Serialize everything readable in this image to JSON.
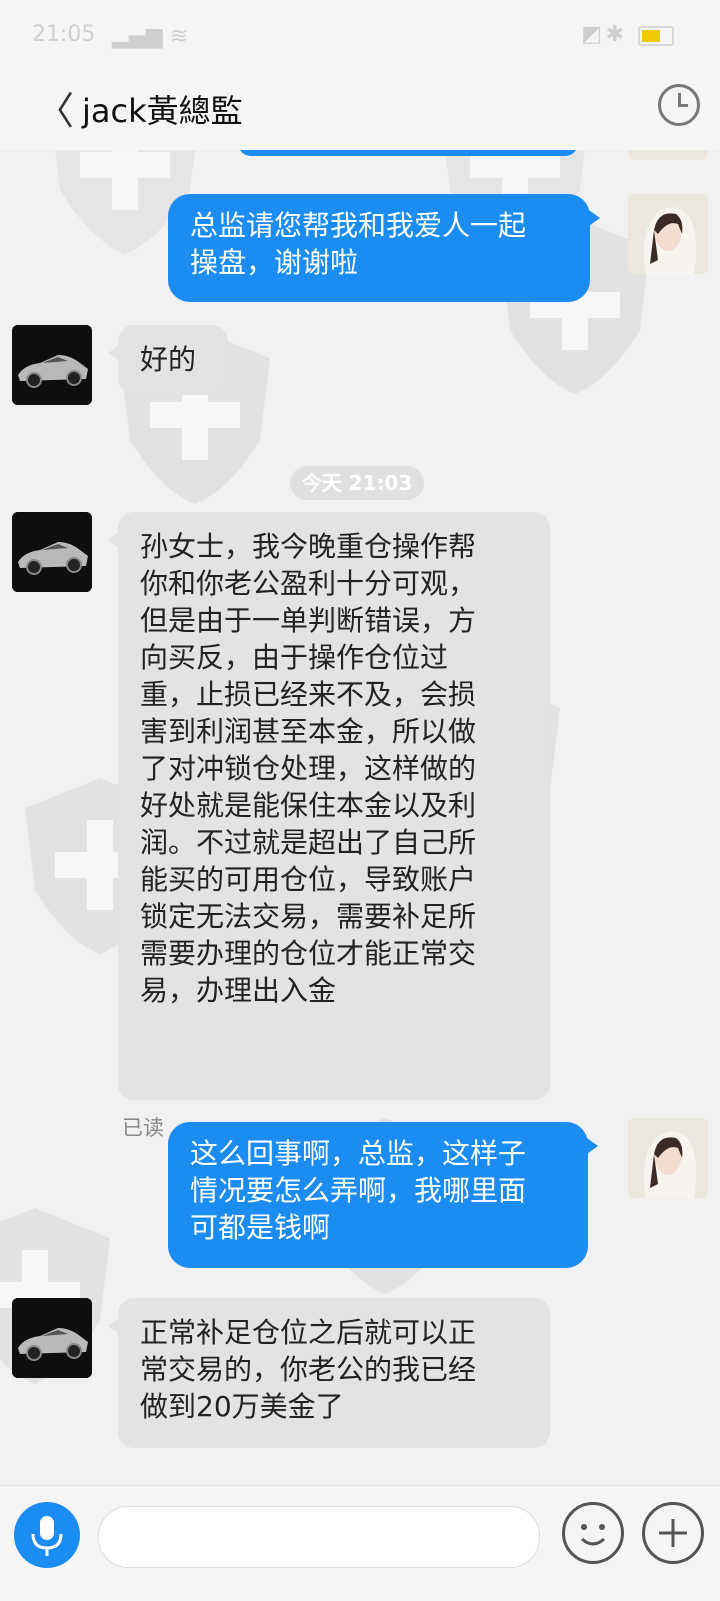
{
  "status_bar": {
    "time": "21:05",
    "signal": "ᵃᵃᵃ",
    "bluetooth": "✱",
    "nodisturb": "▧"
  },
  "header": {
    "back_icon": "<",
    "title": "jack黃總監"
  },
  "messages": [
    {
      "side": "out",
      "text": "总监请您帮我和我爱人一起\n操盘，谢谢啦"
    },
    {
      "side": "in",
      "text": "好的"
    },
    {
      "side": "in",
      "text": "孙女士，我今晚重仓操作帮\n你和你老公盈利十分可观，\n但是由于一单判断错误，方\n向买反，由于操作仓位过\n重，止损已经来不及，会损\n害到利润甚至本金，所以做\n了对冲锁仓处理，这样做的\n好处就是能保住本金以及利\n润。不过就是超出了自己所\n能买的可用仓位，导致账户\n锁定无法交易，需要补足所\n需要办理的仓位才能正常交\n易，办理出入金"
    },
    {
      "side": "out",
      "text": "这么回事啊，总监，这样子\n情况要怎么弄啊，我哪里面\n可都是钱啊"
    },
    {
      "side": "in",
      "text": "正常补足仓位之后就可以正\n常交易的，你老公的我已经\n做到20万美金了"
    }
  ],
  "timestamp": "今天 21:03",
  "read_receipt": "已读",
  "input_bar": {
    "placeholder": ""
  },
  "colors": {
    "out_bubble": "#1b8cf2",
    "in_bubble": "#e3e3e3",
    "background": "#f1f1f1"
  }
}
